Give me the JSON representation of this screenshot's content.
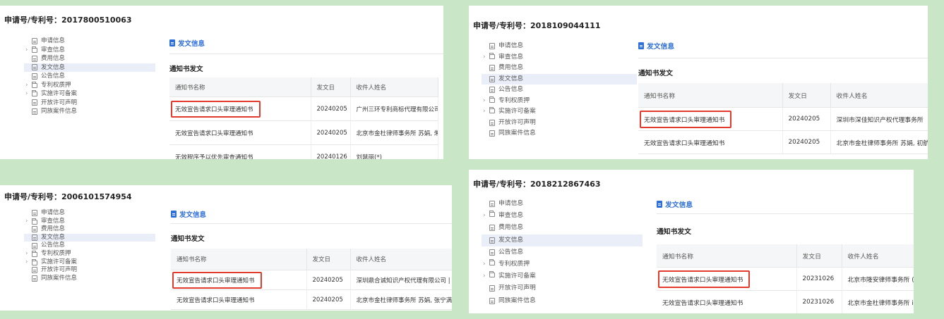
{
  "panels": [
    {
      "title_label": "申请号/专利号：",
      "patent_no": "2017800510063",
      "tree": [
        {
          "label": "申请信息",
          "type": "doc",
          "arrow": false,
          "active": false
        },
        {
          "label": "审查信息",
          "type": "folder",
          "arrow": true,
          "active": false
        },
        {
          "label": "费用信息",
          "type": "doc",
          "arrow": false,
          "active": false
        },
        {
          "label": "发文信息",
          "type": "doc",
          "arrow": false,
          "active": true
        },
        {
          "label": "公告信息",
          "type": "doc",
          "arrow": false,
          "active": false
        },
        {
          "label": "专利权质押",
          "type": "folder",
          "arrow": true,
          "active": false
        },
        {
          "label": "实施许可备案",
          "type": "folder",
          "arrow": true,
          "active": false
        },
        {
          "label": "开放许可声明",
          "type": "doc",
          "arrow": false,
          "active": false
        },
        {
          "label": "同族案件信息",
          "type": "doc",
          "arrow": false,
          "active": false
        }
      ],
      "section_title": "发文信息",
      "table_title": "通知书发文",
      "columns": [
        "通知书名称",
        "发文日",
        "收件人姓名"
      ],
      "rows": [
        {
          "name": "无效宣告请求口头审理通知书",
          "date": "20240205",
          "recipient": "广州三环专利商标代理有限公司 I",
          "highlight": true
        },
        {
          "name": "无效宣告请求口头审理通知书",
          "date": "20240205",
          "recipient": "北京市金杜律师事务所 苏娟, 朱利",
          "highlight": false
        },
        {
          "name": "无效程序予以优先审查通知书",
          "date": "20240126",
          "recipient": "刘慧丽(*)",
          "highlight": false
        }
      ]
    },
    {
      "title_label": "申请号/专利号：",
      "patent_no": "2018109044111",
      "tree": [
        {
          "label": "申请信息",
          "type": "doc",
          "arrow": false,
          "active": false
        },
        {
          "label": "审查信息",
          "type": "folder",
          "arrow": true,
          "active": false
        },
        {
          "label": "费用信息",
          "type": "doc",
          "arrow": false,
          "active": false
        },
        {
          "label": "发文信息",
          "type": "doc",
          "arrow": false,
          "active": true
        },
        {
          "label": "公告信息",
          "type": "doc",
          "arrow": false,
          "active": false
        },
        {
          "label": "专利权质押",
          "type": "folder",
          "arrow": true,
          "active": false
        },
        {
          "label": "实施许可备案",
          "type": "folder",
          "arrow": true,
          "active": false
        },
        {
          "label": "开放许可声明",
          "type": "doc",
          "arrow": false,
          "active": false
        },
        {
          "label": "同族案件信息",
          "type": "doc",
          "arrow": false,
          "active": false
        }
      ],
      "section_title": "发文信息",
      "table_title": "通知书发文",
      "columns": [
        "通知书名称",
        "发文日",
        "收件人姓名"
      ],
      "rows": [
        {
          "name": "无效宣告请求口头审理通知书",
          "date": "20240205",
          "recipient": "深圳市深佳知识产权代理事务所",
          "highlight": true
        },
        {
          "name": "无效宣告请求口头审理通知书",
          "date": "20240205",
          "recipient": "北京市金杜律师事务所 苏娟, 初航",
          "highlight": false
        }
      ]
    },
    {
      "title_label": "申请号/专利号：",
      "patent_no": "2006101574954",
      "tree": [
        {
          "label": "申请信息",
          "type": "doc",
          "arrow": false,
          "active": false
        },
        {
          "label": "审查信息",
          "type": "folder",
          "arrow": true,
          "active": false
        },
        {
          "label": "费用信息",
          "type": "doc",
          "arrow": false,
          "active": false
        },
        {
          "label": "发文信息",
          "type": "doc",
          "arrow": false,
          "active": true
        },
        {
          "label": "公告信息",
          "type": "doc",
          "arrow": false,
          "active": false
        },
        {
          "label": "专利权质押",
          "type": "folder",
          "arrow": true,
          "active": false
        },
        {
          "label": "实施许可备案",
          "type": "folder",
          "arrow": true,
          "active": false
        },
        {
          "label": "开放许可声明",
          "type": "doc",
          "arrow": false,
          "active": false
        },
        {
          "label": "同族案件信息",
          "type": "doc",
          "arrow": false,
          "active": false
        }
      ],
      "section_title": "发文信息",
      "table_title": "通知书发文",
      "columns": [
        "通知书名称",
        "发文日",
        "收件人姓名"
      ],
      "rows": [
        {
          "name": "无效宣告请求口头审理通知书",
          "date": "20240205",
          "recipient": "深圳鼎合诚知识产权代理有限公司 |",
          "highlight": true
        },
        {
          "name": "无效宣告请求口头审理通知书",
          "date": "20240205",
          "recipient": "北京市金杜律师事务所 苏娟, 张宁满",
          "highlight": false
        }
      ]
    },
    {
      "title_label": "申请号/专利号：",
      "patent_no": "2018212867463",
      "tree": [
        {
          "label": "申请信息",
          "type": "doc",
          "arrow": false,
          "active": false
        },
        {
          "label": "审查信息",
          "type": "folder",
          "arrow": true,
          "active": false
        },
        {
          "label": "费用信息",
          "type": "doc",
          "arrow": false,
          "active": false
        },
        {
          "label": "发文信息",
          "type": "doc",
          "arrow": false,
          "active": true
        },
        {
          "label": "公告信息",
          "type": "doc",
          "arrow": false,
          "active": false
        },
        {
          "label": "专利权质押",
          "type": "folder",
          "arrow": true,
          "active": false
        },
        {
          "label": "实施许可备案",
          "type": "folder",
          "arrow": true,
          "active": false
        },
        {
          "label": "开放许可声明",
          "type": "doc",
          "arrow": false,
          "active": false
        },
        {
          "label": "同族案件信息",
          "type": "doc",
          "arrow": false,
          "active": false
        }
      ],
      "section_title": "发文信息",
      "table_title": "通知书发文",
      "columns": [
        "通知书名称",
        "发文日",
        "收件人姓名"
      ],
      "rows": [
        {
          "name": "无效宣告请求口头审理通知书",
          "date": "20231026",
          "recipient": "北京市隆安律师事务所 (",
          "highlight": true
        },
        {
          "name": "无效宣告请求口头审理通知书",
          "date": "20231026",
          "recipient": "北京市金杜律师事务所 i",
          "highlight": false
        }
      ]
    }
  ]
}
